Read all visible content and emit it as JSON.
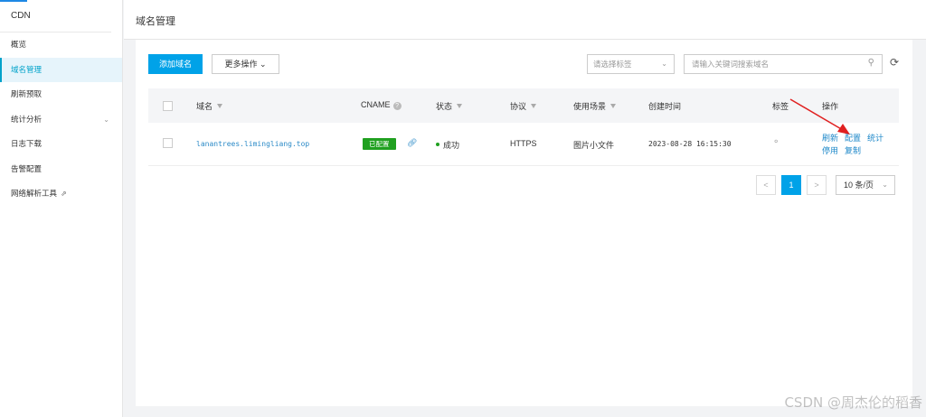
{
  "sidebar": {
    "title": "CDN",
    "items": [
      {
        "label": "概览"
      },
      {
        "label": "域名管理",
        "active": true
      },
      {
        "label": "刷新预取"
      },
      {
        "label": "统计分析",
        "has_children": true
      },
      {
        "label": "日志下载"
      },
      {
        "label": "告警配置"
      },
      {
        "label": "网络解析工具",
        "external": true
      }
    ]
  },
  "header": {
    "title": "域名管理"
  },
  "toolbar": {
    "add_label": "添加域名",
    "more_label": "更多操作",
    "tag_placeholder": "请选择标签",
    "search_placeholder": "请输入关键词搜索域名"
  },
  "table": {
    "headers": {
      "domain": "域名",
      "cname": "CNAME",
      "status": "状态",
      "protocol": "协议",
      "scene": "使用场景",
      "created": "创建时间",
      "tags": "标签",
      "ops": "操作"
    },
    "rows": [
      {
        "domain": "lanantrees.limingliang.top",
        "cname_badge": "已配置",
        "status": "成功",
        "protocol": "HTTPS",
        "scene": "图片小文件",
        "created": "2023-08-28 16:15:30",
        "ops": [
          "刷新",
          "配置",
          "统计",
          "停用",
          "复制"
        ]
      }
    ]
  },
  "pagination": {
    "prev": "<",
    "current": "1",
    "next": ">",
    "page_size": "10 条/页"
  },
  "watermark": "CSDN @周杰伦的稻香",
  "colors": {
    "primary": "#00a2e8",
    "success": "#20a020",
    "link": "#2b8ac7",
    "arrow": "#e02020"
  }
}
